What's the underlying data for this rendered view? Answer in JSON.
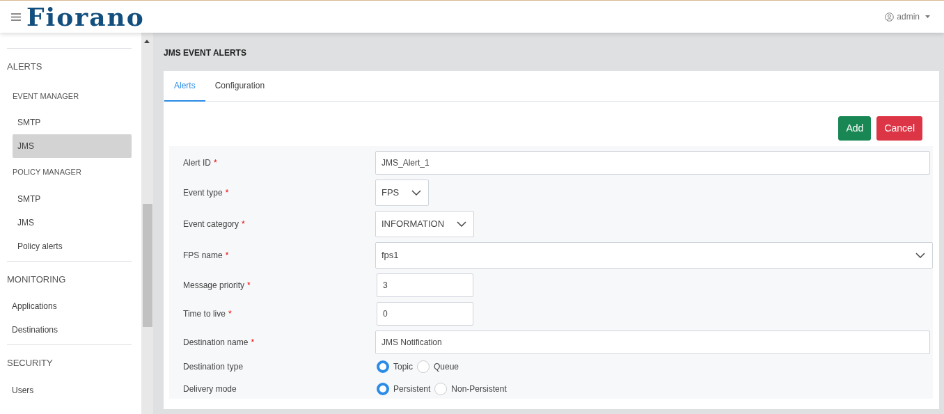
{
  "header": {
    "brand": "Fiorano",
    "user": "admin"
  },
  "sidebar": {
    "sections": [
      {
        "title": "ALERTS",
        "groups": [
          {
            "title": "EVENT MANAGER",
            "items": [
              {
                "label": "SMTP",
                "selected": false
              },
              {
                "label": "JMS",
                "selected": true
              }
            ]
          },
          {
            "title": "POLICY MANAGER",
            "items": [
              {
                "label": "SMTP",
                "selected": false
              },
              {
                "label": "JMS",
                "selected": false
              },
              {
                "label": "Policy alerts",
                "selected": false
              }
            ]
          }
        ]
      },
      {
        "title": "MONITORING",
        "items": [
          {
            "label": "Applications",
            "selected": false
          },
          {
            "label": "Destinations",
            "selected": false
          }
        ]
      },
      {
        "title": "SECURITY",
        "items": [
          {
            "label": "Users",
            "selected": false
          }
        ]
      }
    ]
  },
  "page_title": "JMS EVENT ALERTS",
  "tabs": [
    {
      "label": "Alerts",
      "selected": true
    },
    {
      "label": "Configuration",
      "selected": false
    }
  ],
  "buttons": [
    {
      "label": "Add",
      "kind": "success"
    },
    {
      "label": "Cancel",
      "kind": "danger"
    }
  ],
  "form": [
    {
      "label": "Alert ID",
      "required_mark": "*",
      "kind": "text",
      "value": "JMS_Alert_1"
    },
    {
      "label": "Event type",
      "required_mark": "*",
      "kind": "select",
      "value": "FPS"
    },
    {
      "label": "Event category",
      "required_mark": "*",
      "kind": "select",
      "value": "INFORMATION"
    },
    {
      "label": "FPS name",
      "required_mark": "*",
      "kind": "combo",
      "value": "fps1"
    },
    {
      "label": "Message priority",
      "required_mark": "*",
      "kind": "number",
      "value": "3"
    },
    {
      "label": "Time to live",
      "required_mark": "*",
      "kind": "number",
      "value": "0"
    },
    {
      "label": "Destination name",
      "required_mark": "*",
      "kind": "text",
      "value": "JMS Notification"
    },
    {
      "label": "Destination type",
      "kind": "radio",
      "options": [
        {
          "label": "Topic",
          "selected": true
        },
        {
          "label": "Queue",
          "selected": false
        }
      ]
    },
    {
      "label": "Delivery mode",
      "kind": "radio",
      "options": [
        {
          "label": "Persistent",
          "selected": true
        },
        {
          "label": "Non-Persistent",
          "selected": false
        }
      ]
    }
  ]
}
